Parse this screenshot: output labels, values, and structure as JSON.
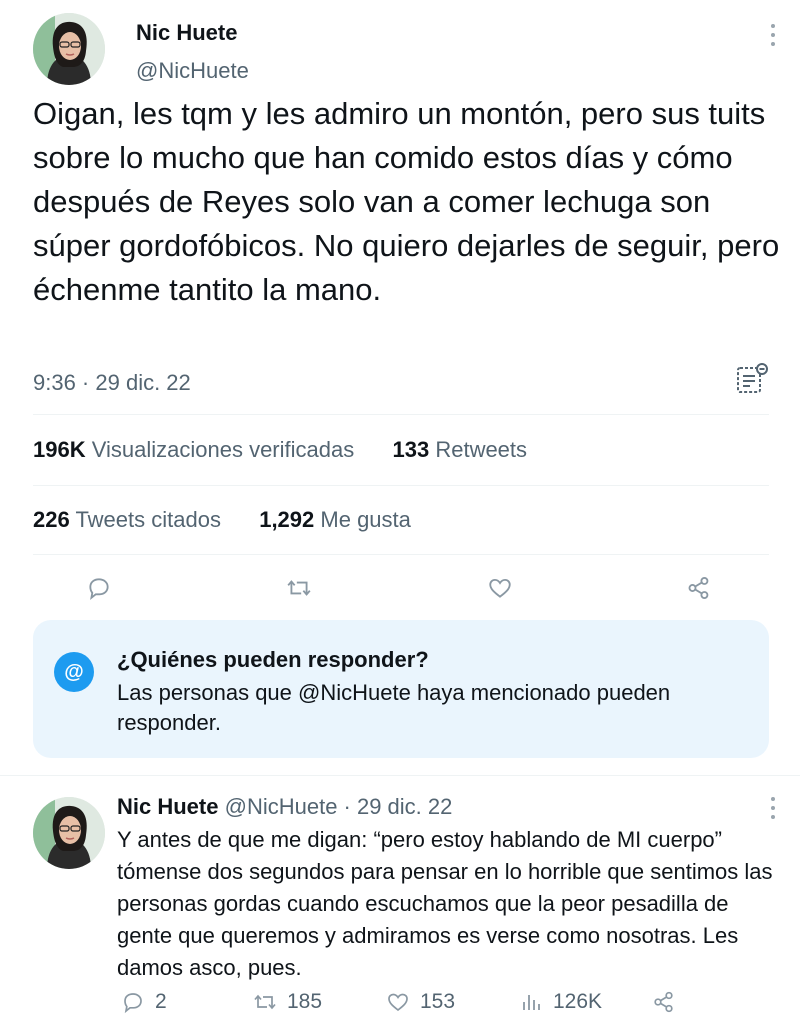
{
  "main_tweet": {
    "display_name": "Nic Huete",
    "handle": "@NicHuete",
    "text": "Oigan, les tqm y les admiro un montón, pero sus tuits sobre lo mucho que han comido estos días y cómo después de Reyes solo van a comer lechuga son súper gordofóbicos. No quiero dejarles de seguir, pero échenme tantito la mano.",
    "timestamp": "9:36 · 29 dic. 22",
    "stats": {
      "views_count": "196K",
      "views_label": "Visualizaciones verificadas",
      "retweets_count": "133",
      "retweets_label": "Retweets",
      "quotes_count": "226",
      "quotes_label": "Tweets citados",
      "likes_count": "1,292",
      "likes_label": "Me gusta"
    },
    "actions": [
      "reply-icon",
      "retweet-icon",
      "like-icon",
      "share-icon"
    ]
  },
  "reply_restriction": {
    "icon": "@",
    "title": "¿Quiénes pueden responder?",
    "body": "Las personas que @NicHuete haya mencionado pueden responder."
  },
  "reply_tweet": {
    "display_name": "Nic Huete",
    "meta": "@NicHuete · 29 dic. 22",
    "text": "Y antes de que me digan: “pero estoy hablando de MI cuerpo” tómense dos segundos para pensar en lo horrible que sentimos las personas gordas cuando escuchamos que la peor pesadilla de gente que queremos y admiramos es verse como nosotras. Les damos asco, pues.",
    "replies": "2",
    "retweets": "185",
    "likes": "153",
    "views": "126K"
  },
  "colors": {
    "text_primary": "#0f1419",
    "text_secondary": "#536471",
    "accent": "#1d9bf0",
    "reply_box_bg": "#eaf5fd",
    "divider": "#eff3f4"
  }
}
